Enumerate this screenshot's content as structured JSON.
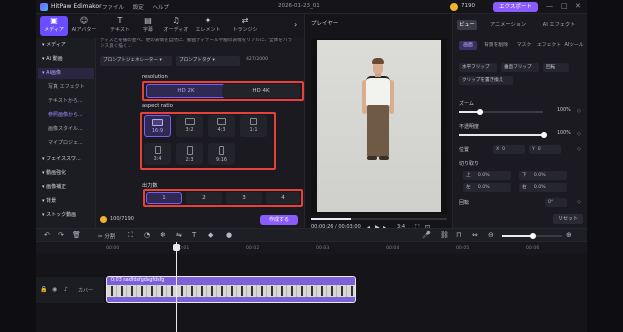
{
  "titlebar": {
    "app_name": "HitPaw Edimakor",
    "menus": [
      "ファイル",
      "設定",
      "ヘルプ"
    ],
    "project": "2026-01-23_01",
    "credits": "7190",
    "export_label": "エクスポート",
    "minimize": "—",
    "maximize": "□",
    "close": "✕"
  },
  "tooltabs": [
    {
      "label": "メディア",
      "icon": "▣"
    },
    {
      "label": "AIアバター",
      "icon": "☺"
    },
    {
      "label": "テキスト",
      "icon": "T"
    },
    {
      "label": "字幕",
      "icon": "▤"
    },
    {
      "label": "オーディオ",
      "icon": "♫"
    },
    {
      "label": "エレメント",
      "icon": "✦"
    },
    {
      "label": "トランジシ",
      "icon": "⇄"
    }
  ],
  "sidebar": {
    "items": [
      {
        "label": "▾ メディア"
      },
      {
        "label": "▾ AI 動画"
      },
      {
        "label": "▾ AI画像"
      },
      {
        "label": "写真 エフェクト"
      },
      {
        "label": "テキストから..."
      },
      {
        "label": "参照画像から..."
      },
      {
        "label": "画像スタイル..."
      },
      {
        "label": "マイプロジェ..."
      },
      {
        "label": "▾ フェイススワ..."
      },
      {
        "label": "▾ 動画強化"
      },
      {
        "label": "▾ 画像補正"
      },
      {
        "label": "▾ 背景"
      },
      {
        "label": "▾ ストック動画"
      }
    ]
  },
  "settings": {
    "description": "ティスと冬服の並べ、更の表情を自然に、動画ディテールや服の表情をリアルに、全体をバランス良く描く...",
    "prompt_generator": "プロンプトジェネレーター ▾",
    "prompt_template": "プロンプトタグ ▾",
    "char_count": "427/2000",
    "resolution": {
      "heading": "resolution",
      "options": [
        "HD 2K",
        "HD 4K"
      ]
    },
    "aspect": {
      "heading": "aspect ratio",
      "options": [
        "16:9",
        "3:2",
        "4:3",
        "1:1",
        "3:4",
        "2:3",
        "9:16"
      ]
    },
    "output": {
      "heading": "出力数",
      "options": [
        "1",
        "2",
        "3",
        "4"
      ]
    },
    "credits_used": "100/7190",
    "create_label": "作成する"
  },
  "preview": {
    "heading": "プレイヤー",
    "time": "00:00:26 / 00:03:00",
    "ratio": "3:4"
  },
  "rightpanel": {
    "tabs": [
      "ビュー",
      "アニメーション",
      "AI エフェクト"
    ],
    "subtabs": [
      "画面",
      "背景を削除",
      "マスク",
      "エフェクト",
      "AIツール"
    ],
    "buttons": [
      "水平フリップ",
      "垂直フリップ",
      "回転",
      "クリップを置き換え"
    ],
    "zoom_label": "ズーム",
    "zoom_value": "100%",
    "opacity_label": "不透明度",
    "opacity_value": "100%",
    "position_label": "位置",
    "pos_x": "0",
    "pos_y": "0",
    "crop_label": "切り取り",
    "crop_top": "0.0%",
    "crop_bottom": "0.0%",
    "crop_left": "0.0%",
    "crop_right": "0.0%",
    "crop_top_label": "上",
    "crop_bottom_label": "下",
    "crop_left_label": "左",
    "crop_right_label": "右",
    "rotate_label": "回転",
    "rotate_value": "0°",
    "reset_label": "リセット"
  },
  "timeline": {
    "split_label": "分割",
    "ticks": [
      "00:00",
      "00:01",
      "00:02",
      "00:03",
      "00:04",
      "00:05",
      "00:06",
      "00:07"
    ],
    "track_label": "カバー",
    "clip_name": "0:03 sadfdsfgdsgfdsfg"
  }
}
